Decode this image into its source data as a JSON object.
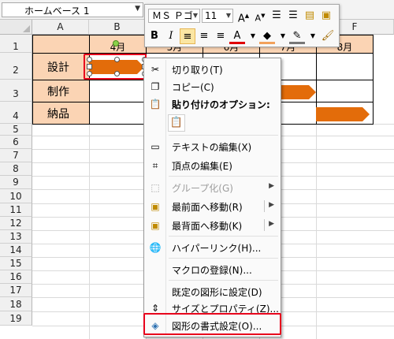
{
  "name_box": {
    "value": "ホームベース 1"
  },
  "columns": [
    "A",
    "B",
    "C",
    "D",
    "E",
    "F"
  ],
  "rows": [
    "1",
    "2",
    "3",
    "4",
    "5",
    "6",
    "7",
    "8",
    "9",
    "10",
    "11",
    "12",
    "13",
    "14",
    "15",
    "16",
    "17",
    "18",
    "19"
  ],
  "cells": {
    "B1": "4月",
    "C1": "5月",
    "D1": "6月",
    "E1": "7月",
    "F1": "8月",
    "A2": "設計",
    "A3": "制作",
    "A4": "納品"
  },
  "mini_toolbar": {
    "font": "ＭＳ Ｐゴ",
    "size": "11"
  },
  "context_menu": {
    "cut": "切り取り(T)",
    "copy": "コピー(C)",
    "paste_heading": "貼り付けのオプション:",
    "edit_text": "テキストの編集(X)",
    "edit_points": "頂点の編集(E)",
    "group": "グループ化(G)",
    "bring_front": "最前面へ移動(R)",
    "send_back": "最背面へ移動(K)",
    "hyperlink": "ハイパーリンク(H)...",
    "assign_macro": "マクロの登録(N)...",
    "set_default": "既定の図形に設定(D)",
    "size_props": "サイズとプロパティ(Z)...",
    "format_shape": "図形の書式設定(O)..."
  },
  "colors": {
    "header_fill": "#fbd4b4",
    "bar": "#e36c0a",
    "highlight": "#e8001c"
  }
}
